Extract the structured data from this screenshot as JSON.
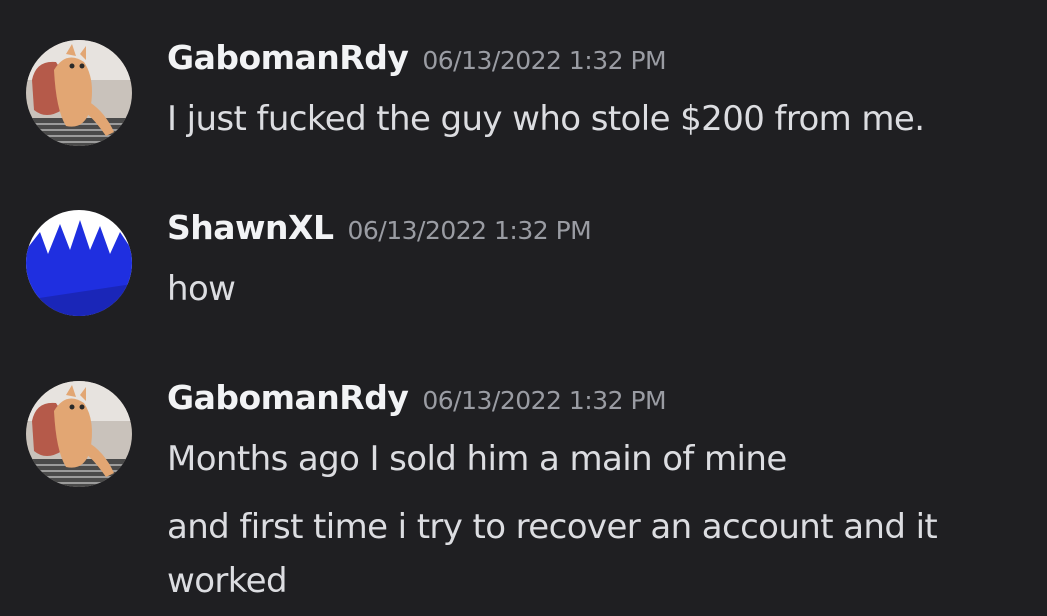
{
  "messages": [
    {
      "username": "GabomanRdy",
      "timestamp": "06/13/2022 1:32 PM",
      "avatar_icon": "cat-avatar-icon",
      "lines": [
        "I just fucked the guy who stole $200 from me."
      ]
    },
    {
      "username": "ShawnXL",
      "timestamp": "06/13/2022 1:32 PM",
      "avatar_icon": "blue-crown-avatar-icon",
      "lines": [
        "how"
      ]
    },
    {
      "username": "GabomanRdy",
      "timestamp": "06/13/2022 1:32 PM",
      "avatar_icon": "cat-avatar-icon",
      "lines": [
        "Months ago I sold him a main of mine",
        "and first time i try to recover an account and it",
        "worked"
      ]
    }
  ],
  "colors": {
    "background": "#1f1f22",
    "username": "#f2f3f5",
    "timestamp": "#9a9ca3",
    "message_text": "#dcdde1",
    "shawn_avatar_blue": "#1f2fe0"
  }
}
